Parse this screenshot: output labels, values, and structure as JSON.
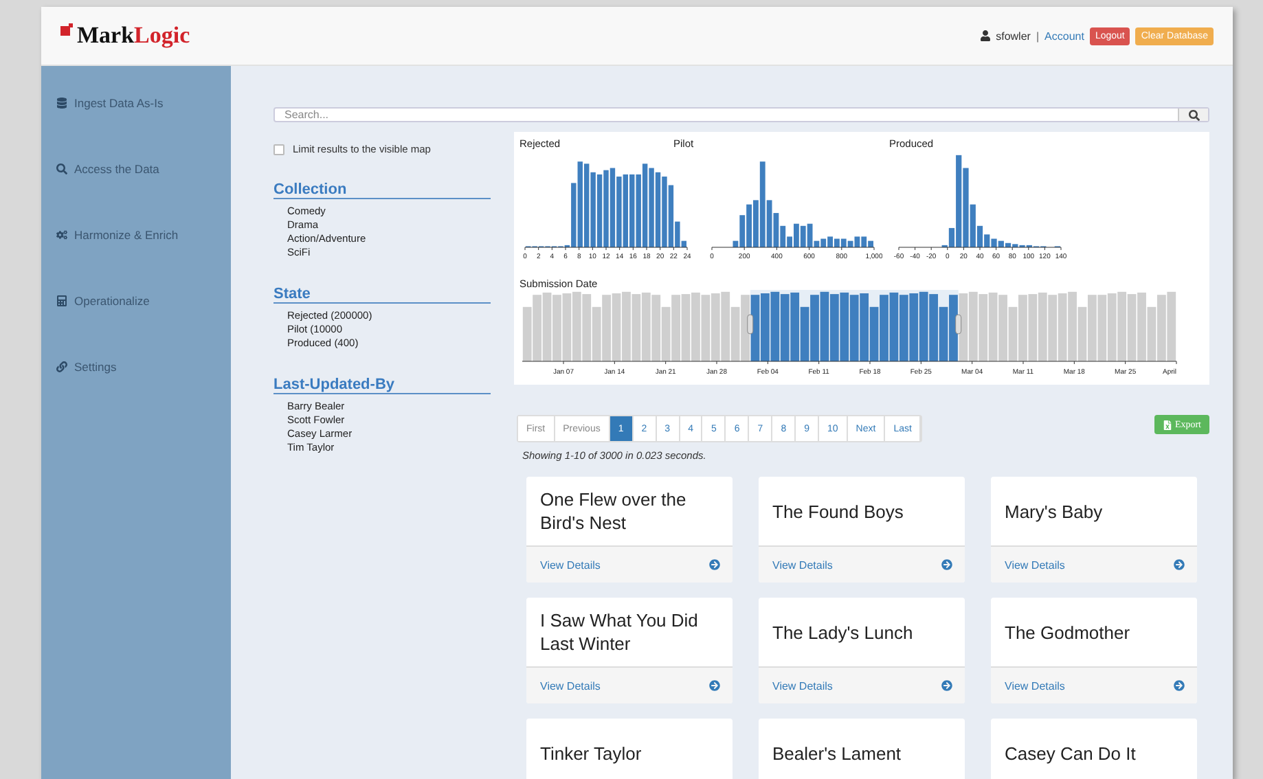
{
  "header": {
    "logo": {
      "mark": "Mark",
      "accent": "Logic"
    },
    "user": "sfowler",
    "separator": "|",
    "account_link": "Account",
    "buttons": [
      {
        "label": "Logout",
        "kind": "danger"
      },
      {
        "label": "Clear Database",
        "kind": "warning"
      }
    ]
  },
  "sidebar": {
    "items": [
      {
        "label": "Ingest Data As-Is"
      },
      {
        "label": "Access the Data"
      },
      {
        "label": "Harmonize & Enrich"
      },
      {
        "label": "Operationalize"
      },
      {
        "label": "Settings"
      }
    ]
  },
  "search": {
    "placeholder": "Search..."
  },
  "limit_to_map": {
    "label": "Limit results to the visible map",
    "checked": false
  },
  "facets": [
    {
      "title": "Collection",
      "values": [
        "Comedy",
        "Drama",
        "Action/Adventure",
        "SciFi"
      ]
    },
    {
      "title": "State",
      "values": [
        "Rejected (200000)",
        "Pilot (10000",
        "Produced (400)"
      ]
    },
    {
      "title": "Last-Updated-By",
      "values": [
        "Barry Bealer",
        "Scott Fowler",
        "Casey Larmer",
        "Tim Taylor"
      ]
    }
  ],
  "histograms": [
    {
      "title": "Rejected",
      "ticks": [
        "0",
        "2",
        "4",
        "6",
        "8",
        "10",
        "12",
        "14",
        "16",
        "18",
        "20",
        "22",
        "24"
      ]
    },
    {
      "title": "Pilot",
      "ticks": [
        "0",
        "200",
        "400",
        "600",
        "800",
        "1,000"
      ]
    },
    {
      "title": "Produced",
      "ticks": [
        "-60",
        "-40",
        "-20",
        "0",
        "20",
        "40",
        "60",
        "80",
        "100",
        "120",
        "140"
      ]
    }
  ],
  "timeline": {
    "title": "Submission Date",
    "ticks": [
      "Jan 07",
      "Jan 14",
      "Jan 21",
      "Jan 28",
      "Feb 04",
      "Feb 11",
      "Feb 18",
      "Feb 25",
      "Mar 04",
      "Mar 11",
      "Mar 18",
      "Mar 25",
      "April"
    ]
  },
  "pagination": [
    {
      "label": "First",
      "selected": false
    },
    {
      "label": "Previous",
      "selected": false
    },
    {
      "label": "1",
      "selected": true
    },
    {
      "label": "2",
      "selected": false
    },
    {
      "label": "3",
      "selected": false
    },
    {
      "label": "4",
      "selected": false
    },
    {
      "label": "5",
      "selected": false
    },
    {
      "label": "6",
      "selected": false
    },
    {
      "label": "7",
      "selected": false
    },
    {
      "label": "8",
      "selected": false
    },
    {
      "label": "9",
      "selected": false
    },
    {
      "label": "10",
      "selected": false
    },
    {
      "label": "Next",
      "selected": false
    },
    {
      "label": "Last",
      "selected": false
    }
  ],
  "export_button": "Export",
  "result_summary": "Showing 1-10 of 3000 in 0.023 seconds.",
  "results": [
    {
      "title": "One Flew over the Bird's Nest",
      "link": "View Details"
    },
    {
      "title": "The Found Boys",
      "link": "View Details"
    },
    {
      "title": "Mary's Baby",
      "link": "View Details"
    },
    {
      "title": "I Saw What You Did Last Winter",
      "link": "View Details"
    },
    {
      "title": "The Lady's Lunch",
      "link": "View Details"
    },
    {
      "title": "The Godmother",
      "link": "View Details"
    },
    {
      "title": "Tinker Taylor"
    },
    {
      "title": "Bealer's Lament"
    },
    {
      "title": "Casey Can Do It"
    }
  ]
}
